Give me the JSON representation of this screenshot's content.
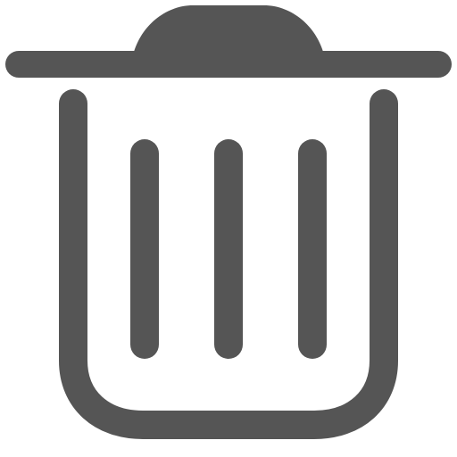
{
  "icon": {
    "name": "trash-icon",
    "color": "#555555",
    "background": "#ffffff"
  }
}
